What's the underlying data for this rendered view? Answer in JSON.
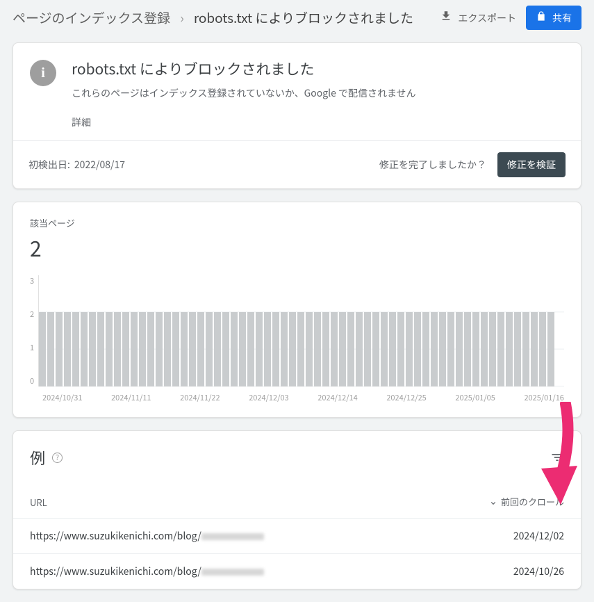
{
  "topbar": {
    "breadcrumb_parent": "ページのインデックス登録",
    "breadcrumb_current": "robots.txt によりブロックされました",
    "export_label": "エクスポート",
    "share_label": "共有"
  },
  "status_card": {
    "title": "robots.txt によりブロックされました",
    "subtitle": "これらのページはインデックス登録されていないか、Google で配信されません",
    "learn_more": "詳細",
    "first_detected_label": "初検出日:",
    "first_detected_value": "2022/08/17",
    "prompt": "修正を完了しましたか？",
    "validate_button": "修正を検証"
  },
  "chart_card": {
    "label": "該当ページ",
    "count": "2"
  },
  "chart_data": {
    "type": "bar",
    "title": "",
    "xlabel": "",
    "ylabel": "",
    "ylim": [
      0,
      3
    ],
    "y_ticks": [
      3,
      2,
      1,
      0
    ],
    "x_ticks": [
      "2024/10/31",
      "2024/11/11",
      "2024/11/22",
      "2024/12/03",
      "2024/12/14",
      "2024/12/25",
      "2025/01/05",
      "2025/01/16"
    ],
    "categories": null,
    "values_constant": 2,
    "num_points": 62
  },
  "examples_card": {
    "title": "例",
    "columns": {
      "url": "URL",
      "last_crawl": "前回のクロール"
    },
    "rows": [
      {
        "url_prefix": "https://www.suzukikenichi.com/blog/",
        "last_crawl": "2024/12/02"
      },
      {
        "url_prefix": "https://www.suzukikenichi.com/blog/",
        "last_crawl": "2024/10/26"
      }
    ]
  },
  "icons": {
    "chevron": "›",
    "info": "i"
  }
}
